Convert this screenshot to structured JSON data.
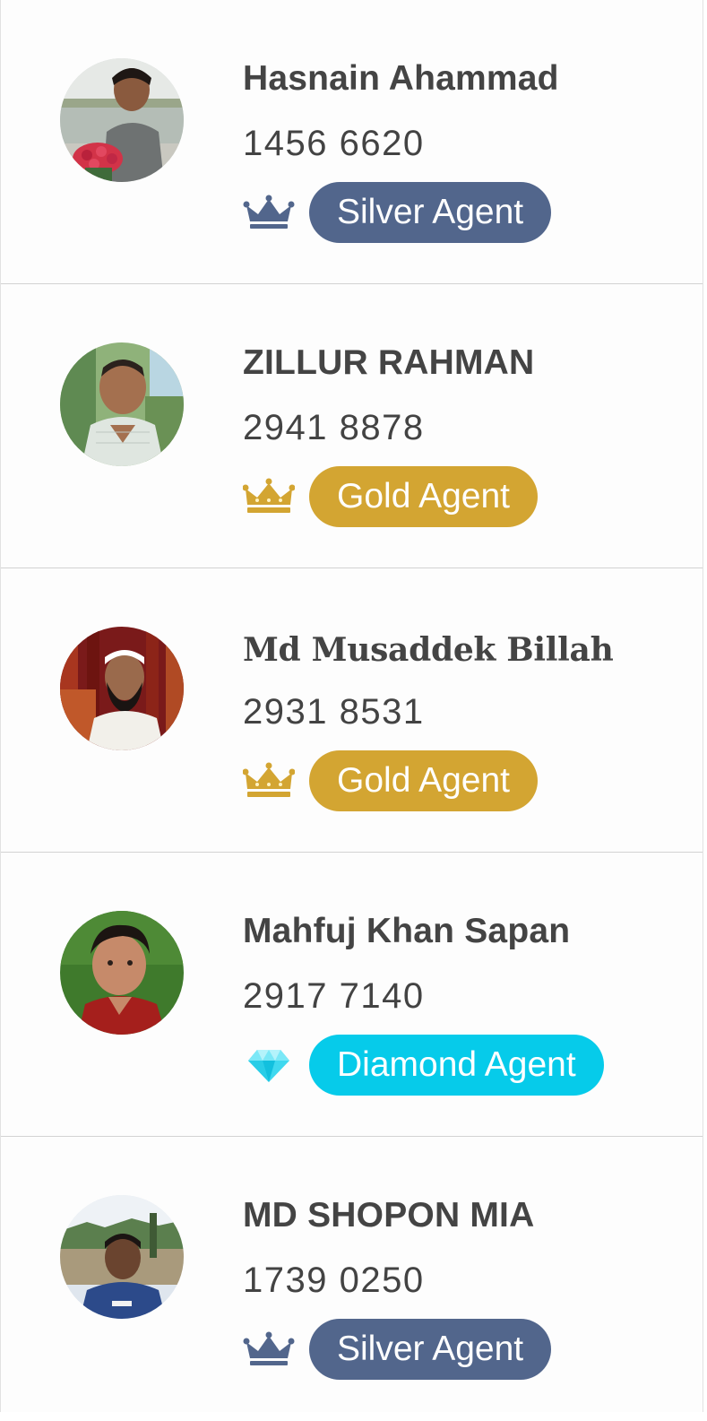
{
  "colors": {
    "silver": "#52668c",
    "gold": "#d3a532",
    "diamond": "#06cbea",
    "text": "#444444"
  },
  "agents": [
    {
      "name": "Hasnain Ahammad",
      "phone": "1456 6620",
      "tier_label": "Silver Agent",
      "tier_icon": "crown-icon"
    },
    {
      "name": "ZILLUR RAHMAN",
      "phone": "2941 8878",
      "tier_label": "Gold Agent",
      "tier_icon": "crown-icon"
    },
    {
      "name": "Md Musaddek Billah",
      "phone": "2931 8531",
      "tier_label": "Gold Agent",
      "tier_icon": "crown-icon"
    },
    {
      "name": "Mahfuj Khan Sapan",
      "phone": "2917 7140",
      "tier_label": "Diamond Agent",
      "tier_icon": "diamond-icon"
    },
    {
      "name": "MD SHOPON MIA",
      "phone": "1739 0250",
      "tier_label": "Silver Agent",
      "tier_icon": "crown-icon"
    }
  ]
}
